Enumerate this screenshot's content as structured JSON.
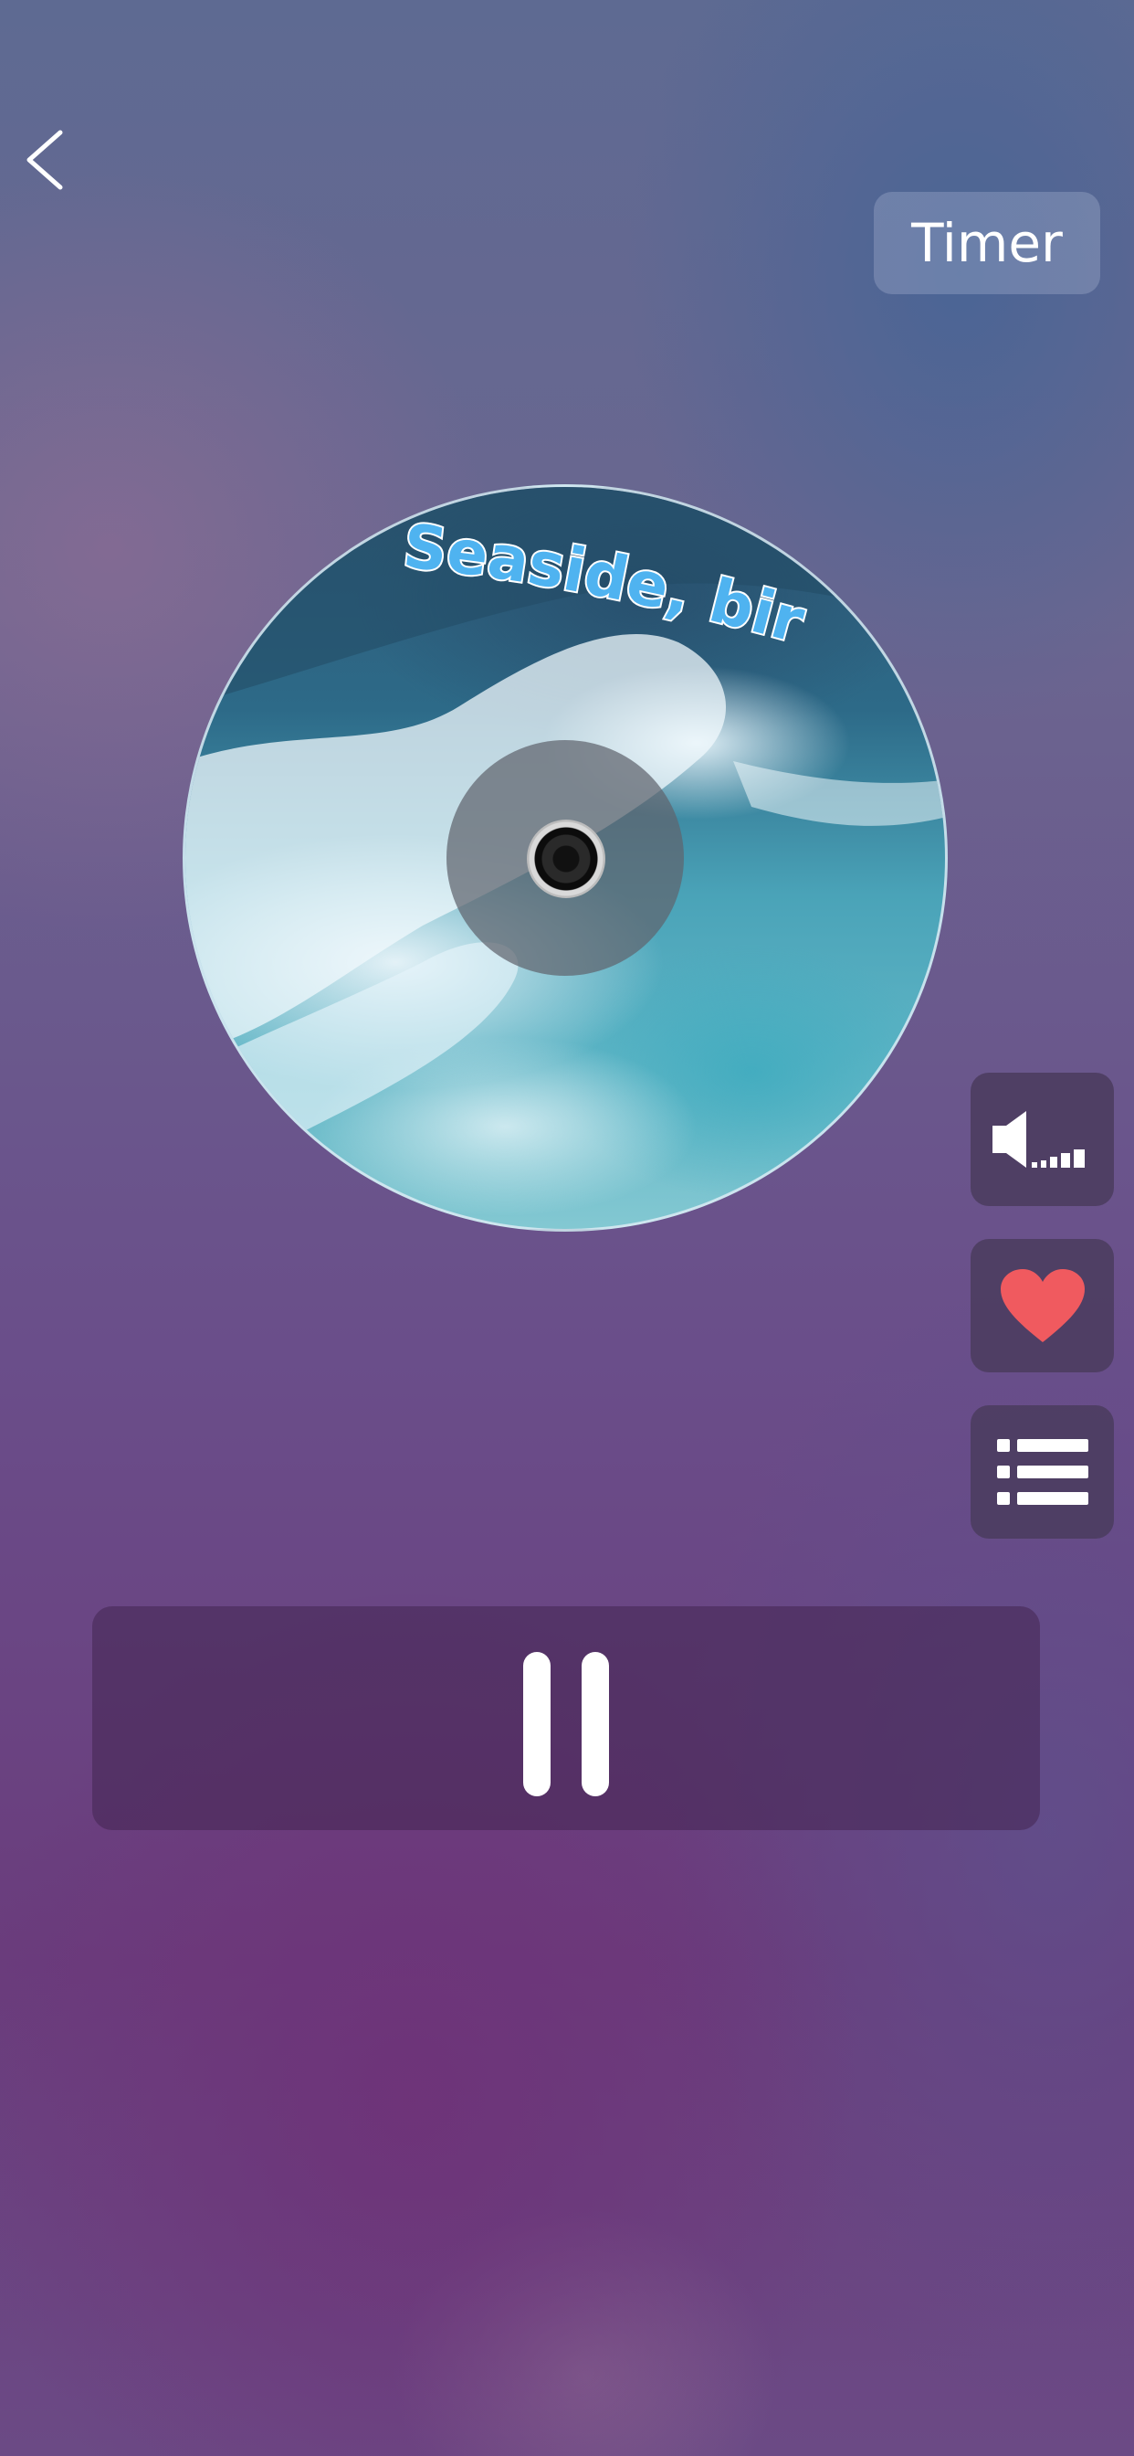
{
  "header": {
    "timer_label": "Timer"
  },
  "disc": {
    "title": "Seaside, bird"
  },
  "side_actions": [
    {
      "icon": "volume-icon"
    },
    {
      "icon": "heart-icon",
      "color": "#f05a5f"
    },
    {
      "icon": "playlist-icon"
    }
  ],
  "player": {
    "state_icon": "pause-icon"
  }
}
